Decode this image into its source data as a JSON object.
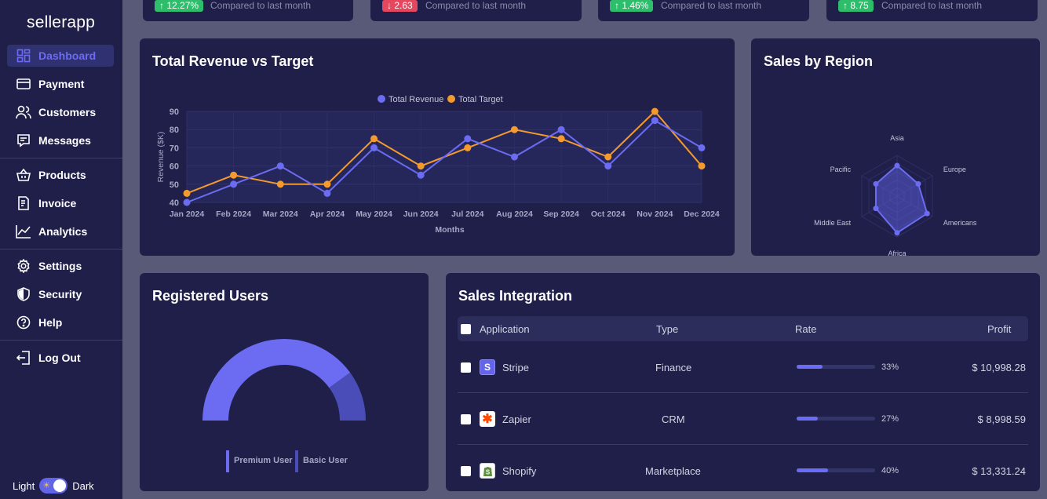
{
  "app": {
    "logo": "sellerapp"
  },
  "sidebar": {
    "items": [
      {
        "label": "Dashboard",
        "icon": "dashboard-icon"
      },
      {
        "label": "Payment",
        "icon": "credit-card-icon"
      },
      {
        "label": "Customers",
        "icon": "users-icon"
      },
      {
        "label": "Messages",
        "icon": "message-icon"
      },
      {
        "label": "Products",
        "icon": "basket-icon"
      },
      {
        "label": "Invoice",
        "icon": "invoice-icon"
      },
      {
        "label": "Analytics",
        "icon": "analytics-icon"
      },
      {
        "label": "Settings",
        "icon": "gear-icon"
      },
      {
        "label": "Security",
        "icon": "shield-icon"
      },
      {
        "label": "Help",
        "icon": "help-icon"
      },
      {
        "label": "Log Out",
        "icon": "logout-icon"
      }
    ],
    "theme": {
      "light": "Light",
      "dark": "Dark",
      "current": "Dark"
    }
  },
  "stats": [
    {
      "badge": "↑ 12.27%",
      "trend": "up",
      "compare": "Compared to last month"
    },
    {
      "badge": "↓ 2.63",
      "trend": "down",
      "compare": "Compared to last month"
    },
    {
      "badge": "↑ 1.46%",
      "trend": "up",
      "compare": "Compared to last month"
    },
    {
      "badge": "↑ 8.75",
      "trend": "up",
      "compare": "Compared to last month"
    }
  ],
  "revenue_card": {
    "title": "Total Revenue vs Target"
  },
  "region_card": {
    "title": "Sales by Region"
  },
  "users_card": {
    "title": "Registered Users"
  },
  "integration": {
    "title": "Sales Integration",
    "headers": {
      "application": "Application",
      "type": "Type",
      "rate": "Rate",
      "profit": "Profit"
    },
    "rows": [
      {
        "app": "Stripe",
        "icon": "stripe-icon",
        "type": "Finance",
        "rate": 0.33,
        "rate_label": "33%",
        "profit": "$ 10,998.28"
      },
      {
        "app": "Zapier",
        "icon": "zapier-icon",
        "type": "CRM",
        "rate": 0.27,
        "rate_label": "27%",
        "profit": "$ 8,998.59"
      },
      {
        "app": "Shopify",
        "icon": "shopify-icon",
        "type": "Marketplace",
        "rate": 0.4,
        "rate_label": "40%",
        "profit": "$ 13,331.24"
      }
    ]
  },
  "colors": {
    "accent": "#6d6bf5",
    "revenue": "#6c6cf2",
    "target": "#f59a2c",
    "basic_user": "#4a4db8",
    "up": "#2ebd6b",
    "down": "#e5485e"
  },
  "chart_data": [
    {
      "type": "line",
      "categories": [
        "Jan 2024",
        "Feb 2024",
        "Mar 2024",
        "Apr 2024",
        "May 2024",
        "Jun 2024",
        "Jul 2024",
        "Aug 2024",
        "Sep 2024",
        "Oct 2024",
        "Nov 2024",
        "Dec 2024"
      ],
      "series": [
        {
          "name": "Total Revenue",
          "values": [
            40,
            50,
            60,
            45,
            70,
            55,
            75,
            65,
            80,
            60,
            85,
            70
          ]
        },
        {
          "name": "Total Target",
          "values": [
            45,
            55,
            50,
            50,
            75,
            60,
            70,
            80,
            75,
            65,
            90,
            60
          ]
        }
      ],
      "xlabel": "Months",
      "ylabel": "Revenue ($K)",
      "ylim": [
        40,
        90
      ],
      "yticks": [
        "40",
        "50",
        "60",
        "70",
        "80",
        "90"
      ],
      "legend": "top-center",
      "grid": true
    },
    {
      "type": "radar",
      "categories": [
        "Asia",
        "Europe",
        "Americans",
        "Africa",
        "Middle East",
        "Pacific"
      ],
      "values": [
        0.75,
        0.6,
        0.85,
        0.9,
        0.6,
        0.6
      ],
      "legend": "none"
    },
    {
      "type": "pie",
      "subtype": "semi-donut",
      "categories": [
        "Premium User",
        "Basic User"
      ],
      "values": [
        0.8,
        0.2
      ],
      "legend": "bottom"
    }
  ]
}
